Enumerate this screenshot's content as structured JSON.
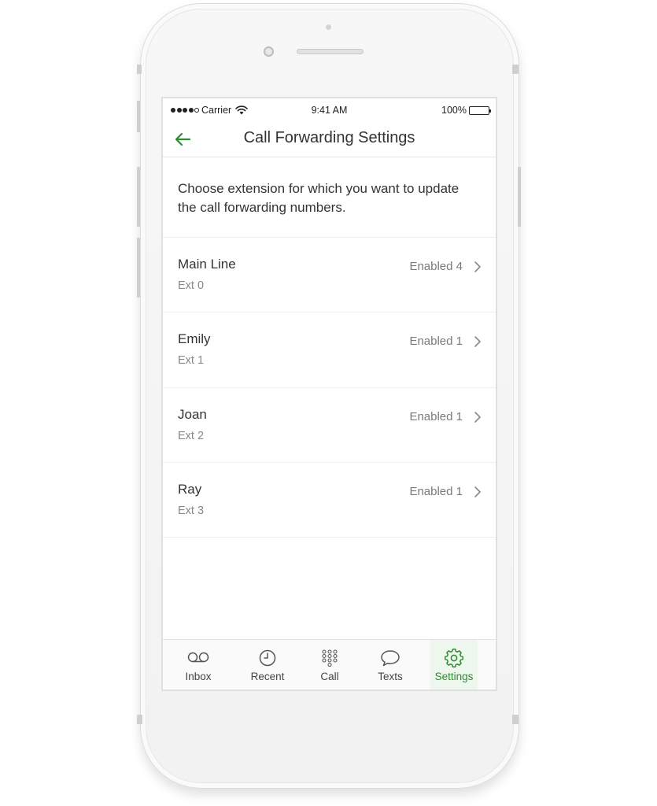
{
  "status_bar": {
    "carrier": "Carrier",
    "time": "9:41 AM",
    "battery": "100%",
    "battery_color": "#4cd964"
  },
  "header": {
    "title": "Call Forwarding Settings",
    "back_icon": "arrow-left-icon",
    "accent_color": "#2e8b2e"
  },
  "intro": {
    "text": "Choose extension for which you want to update the call forwarding numbers."
  },
  "extensions": [
    {
      "name": "Main Line",
      "ext": "Ext 0",
      "status": "Enabled 4"
    },
    {
      "name": "Emily",
      "ext": "Ext 1",
      "status": "Enabled 1"
    },
    {
      "name": "Joan",
      "ext": "Ext 2",
      "status": "Enabled 1"
    },
    {
      "name": "Ray",
      "ext": "Ext 3",
      "status": "Enabled 1"
    }
  ],
  "tabs": [
    {
      "label": "Inbox",
      "icon": "voicemail-icon"
    },
    {
      "label": "Recent",
      "icon": "clock-icon"
    },
    {
      "label": "Call",
      "icon": "keypad-icon"
    },
    {
      "label": "Texts",
      "icon": "chat-bubble-icon"
    },
    {
      "label": "Settings",
      "icon": "gear-icon",
      "active": true
    }
  ]
}
